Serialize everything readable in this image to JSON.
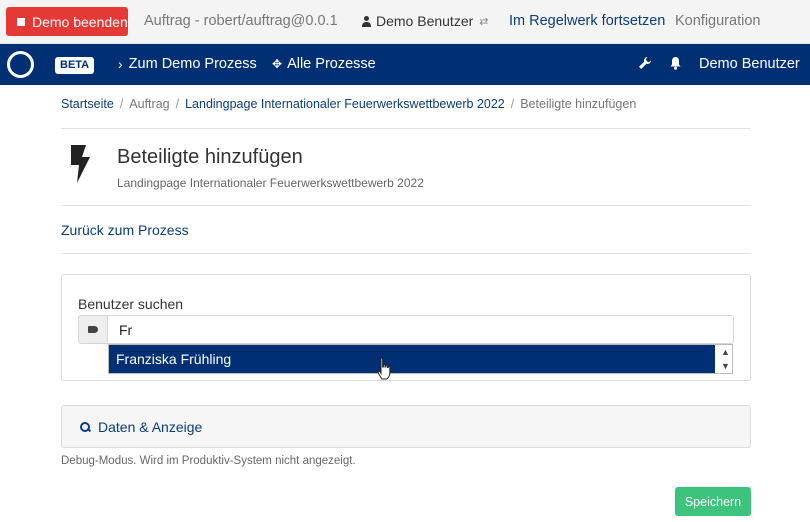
{
  "demo_bar": {
    "end_button": "Demo beenden",
    "order": "Auftrag - robert/auftrag@0.0.1",
    "user": "Demo Benutzer",
    "swap_icon": "⇄",
    "continue_link": "Im Regelwerk fortsetzen",
    "config_link": "Konfiguration"
  },
  "navbar": {
    "beta": "BETA",
    "demo_process": "Zum Demo Prozess",
    "all_processes": "Alle Prozesse",
    "user": "Demo Benutzer",
    "chevron_icon": "›",
    "grid_icon": "✥",
    "wrench_icon": "🔧",
    "bell_icon": "🔔"
  },
  "breadcrumb": {
    "home": "Startseite",
    "order": "Auftrag",
    "landing": "Landingpage Internationaler Feuerwerkswettbewerb 2022",
    "current": "Beteiligte hinzufügen",
    "separator": "/"
  },
  "header": {
    "title": "Beteiligte hinzufügen",
    "subtitle": "Landingpage Internationaler Feuerwerkswettbewerb 2022"
  },
  "back_link": "Zurück zum Prozess",
  "search": {
    "label": "Benutzer suchen",
    "value": "Fr",
    "suggestion": "Franziska Frühling",
    "scroll_up": "▲",
    "scroll_down": "▼"
  },
  "data_panel": {
    "label": "Daten & Anzeige",
    "debug_note": "Debug-Modus. Wird im Produktiv-System nicht angezeigt."
  },
  "save_button": "Speichern",
  "colors": {
    "navbar": "#003073",
    "danger": "#e53935",
    "success": "#3cc47c",
    "link": "#0b3c7d"
  }
}
